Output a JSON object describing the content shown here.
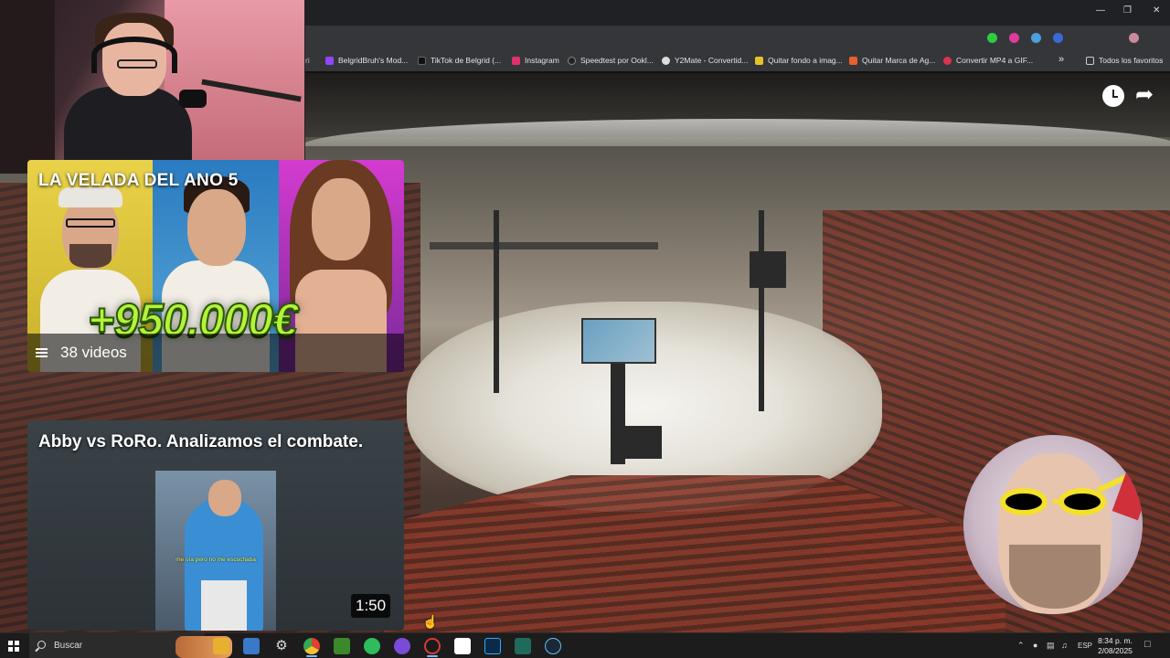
{
  "bookmarks": [
    {
      "label": "BelgridBruh's Mod...",
      "icon": "twitch-icon",
      "color": "#9146ff"
    },
    {
      "label": "TikTok de Belgrid (...",
      "icon": "tiktok-icon",
      "color": "#111111"
    },
    {
      "label": "Instagram",
      "icon": "instagram-icon",
      "color": "#e1306c"
    },
    {
      "label": "Speedtest por Ookl...",
      "icon": "speedtest-icon",
      "color": "#222222"
    },
    {
      "label": "Y2Mate - Convertid...",
      "icon": "y2mate-icon",
      "color": "#dddddd"
    },
    {
      "label": "Quitar fondo a imag...",
      "icon": "removebg-icon",
      "color": "#e6c229"
    },
    {
      "label": "Quitar Marca de Ag...",
      "icon": "watermark-icon",
      "color": "#e8602c"
    },
    {
      "label": "Convertir MP4 a GIF...",
      "icon": "gif-icon",
      "color": "#d9344a"
    }
  ],
  "bookmarks_more": "»",
  "all_bookmarks": "Todos los favoritos",
  "end_screen": {
    "playlist": {
      "title": "LA VELADA DEL ANO 5",
      "overlay_text": "+950.000€",
      "video_count": "38 videos"
    },
    "video": {
      "title": "Abby vs RoRo. Analizamos el combate.",
      "subtitle": "me oía pero no me escuchaba",
      "duration": "1:50"
    }
  },
  "taskbar": {
    "search_placeholder": "Buscar",
    "language": "ESP",
    "time": "8:34 p. m.",
    "date": "2/08/2025"
  }
}
